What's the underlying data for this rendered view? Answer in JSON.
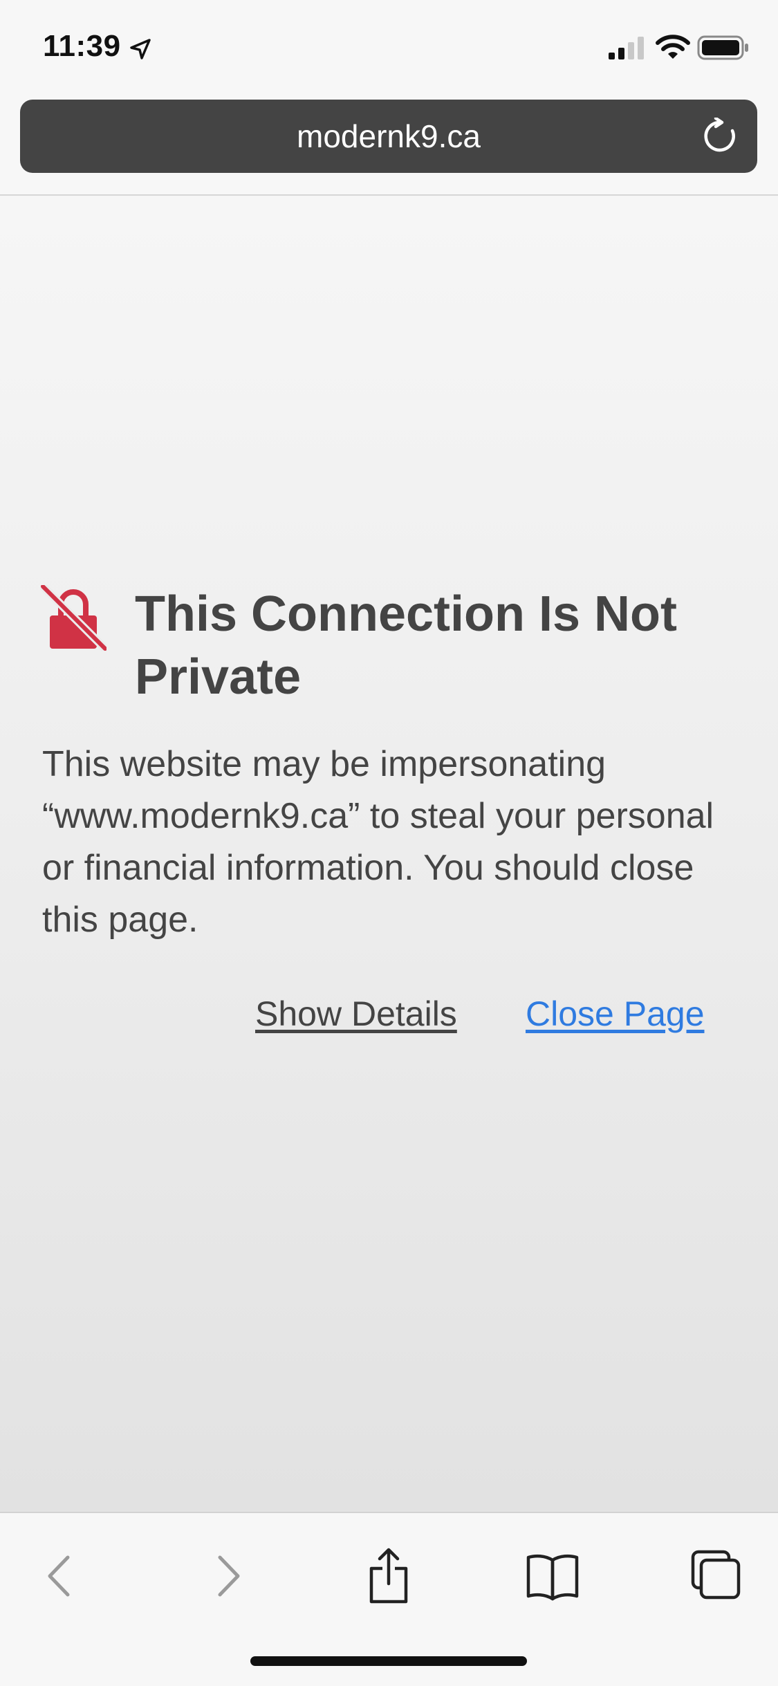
{
  "status_bar": {
    "time": "11:39",
    "icons": [
      "location-arrow-icon",
      "cellular-signal-icon",
      "wifi-icon",
      "battery-icon"
    ]
  },
  "address_bar": {
    "url": "modernk9.ca",
    "reload_icon": "reload-icon"
  },
  "error_page": {
    "icon": "unlocked-lock-icon",
    "title": "This Connection Is Not Private",
    "message": "This website may be impersonating “www.modernk9.ca” to steal your personal or financial information. You should close this page.",
    "show_details_label": "Show Details",
    "close_page_label": "Close Page"
  },
  "toolbar": {
    "items": [
      "back-icon",
      "forward-icon",
      "share-icon",
      "bookmarks-icon",
      "tabs-icon"
    ]
  },
  "colors": {
    "warning_icon": "#d03245",
    "link_blue": "#2f7be0",
    "address_bar_bg": "#444444",
    "text_dark": "#444444",
    "disabled_gray": "#9a9a9a"
  }
}
